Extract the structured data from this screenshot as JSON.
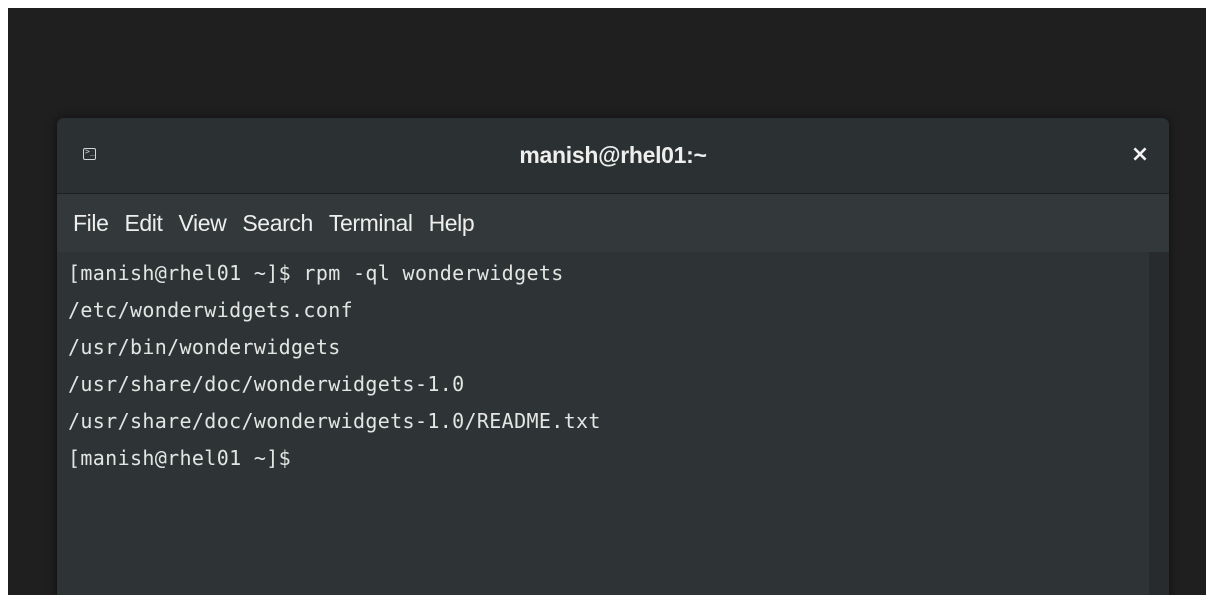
{
  "window": {
    "title": "manish@rhel01:~",
    "icon": "terminal-icon",
    "close_icon": "close-icon",
    "close_label": "×"
  },
  "menu": [
    {
      "label": "File"
    },
    {
      "label": "Edit"
    },
    {
      "label": "View"
    },
    {
      "label": "Search"
    },
    {
      "label": "Terminal"
    },
    {
      "label": "Help"
    }
  ],
  "terminal": {
    "lines": [
      "[manish@rhel01 ~]$ rpm -ql wonderwidgets",
      "/etc/wonderwidgets.conf",
      "/usr/bin/wonderwidgets",
      "/usr/share/doc/wonderwidgets-1.0",
      "/usr/share/doc/wonderwidgets-1.0/README.txt",
      "[manish@rhel01 ~]$"
    ]
  },
  "colors": {
    "desktop_background": "#1f1f1f",
    "titlebar": "#2b3033",
    "menubar": "#33393b",
    "terminal_background": "#2e3436",
    "terminal_text": "#e3e5e2"
  }
}
